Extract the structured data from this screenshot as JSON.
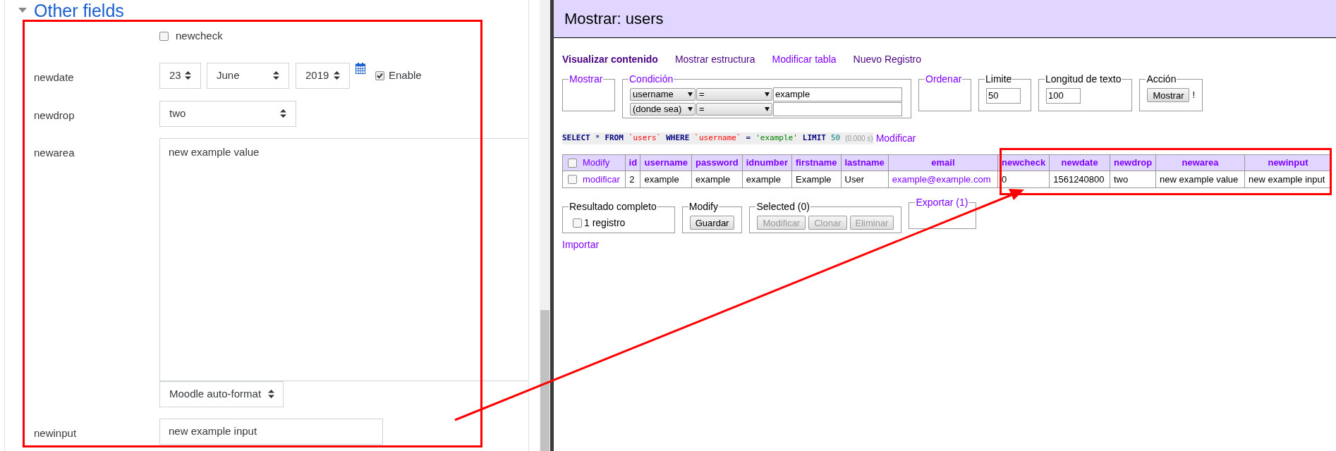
{
  "form": {
    "section": {
      "title": "Other fields",
      "expanded": true
    },
    "fields": [
      {
        "kind": "checkbox",
        "label": "newcheck",
        "checked": false
      },
      {
        "kind": "date",
        "label": "newdate",
        "day": "23",
        "month": "June",
        "year": "2019",
        "enable_label": "Enable",
        "enabled": true
      },
      {
        "kind": "select",
        "label": "newdrop",
        "value": "two"
      },
      {
        "kind": "textarea",
        "label": "newarea",
        "value": "new example value",
        "format": "Moodle auto-format"
      },
      {
        "kind": "input",
        "label": "newinput",
        "value": "new example input"
      }
    ]
  },
  "adminer": {
    "title": "Mostrar: users",
    "nav": [
      {
        "label": "Visualizar contenido",
        "selected": true,
        "visited": true
      },
      {
        "label": "Mostrar estructura",
        "selected": false,
        "visited": true
      },
      {
        "label": "Modificar tabla",
        "selected": false,
        "visited": false
      },
      {
        "label": "Nuevo Registro",
        "selected": false,
        "visited": true
      }
    ],
    "filters": [
      {
        "kind": "empty",
        "legend": "Mostrar",
        "legend_link": true
      },
      {
        "kind": "condition",
        "legend": "Condición",
        "legend_link": true,
        "rows": [
          {
            "column": "username",
            "operator": "=",
            "value": "example"
          },
          {
            "column": "(donde sea)",
            "operator": "=",
            "value": ""
          }
        ]
      },
      {
        "kind": "empty",
        "legend": "Ordenar",
        "legend_link": true
      },
      {
        "kind": "input",
        "legend": "Limite",
        "legend_link": false,
        "value": "50"
      },
      {
        "kind": "input",
        "legend": "Longitud de texto",
        "legend_link": false,
        "value": "100"
      },
      {
        "kind": "action",
        "legend": "Acción",
        "legend_link": false,
        "button": "Mostrar",
        "note": "!"
      }
    ],
    "sql": {
      "tokens": [
        {
          "kind": "keyword",
          "text": "SELECT"
        },
        {
          "kind": "operator",
          "text": "*"
        },
        {
          "kind": "keyword",
          "text": "FROM"
        },
        {
          "kind": "identifier",
          "text": "`users`"
        },
        {
          "kind": "keyword",
          "text": "WHERE"
        },
        {
          "kind": "identifier",
          "text": "`username`"
        },
        {
          "kind": "operator",
          "text": "="
        },
        {
          "kind": "string",
          "text": "'example'"
        },
        {
          "kind": "keyword",
          "text": "LIMIT"
        },
        {
          "kind": "number",
          "text": "50"
        }
      ],
      "time": "(0.000 s)",
      "edit_link": "Modificar"
    },
    "table": {
      "columns": [
        {
          "label": "Modify",
          "kind": "select-all",
          "checked": false
        },
        {
          "label": "id",
          "kind": "field"
        },
        {
          "label": "username",
          "kind": "field"
        },
        {
          "label": "password",
          "kind": "field"
        },
        {
          "label": "idnumber",
          "kind": "field"
        },
        {
          "label": "firstname",
          "kind": "field"
        },
        {
          "label": "lastname",
          "kind": "field"
        },
        {
          "label": "email",
          "kind": "field"
        },
        {
          "label": "newcheck",
          "kind": "field"
        },
        {
          "label": "newdate",
          "kind": "field"
        },
        {
          "label": "newdrop",
          "kind": "field"
        },
        {
          "label": "newarea",
          "kind": "field"
        },
        {
          "label": "newinput",
          "kind": "field"
        }
      ],
      "rows": [
        {
          "selected": false,
          "cells": [
            {
              "text": "modificar",
              "kind": "action"
            },
            {
              "text": "2",
              "kind": "text"
            },
            {
              "text": "example",
              "kind": "text"
            },
            {
              "text": "example",
              "kind": "text"
            },
            {
              "text": "example",
              "kind": "text"
            },
            {
              "text": "Example",
              "kind": "text"
            },
            {
              "text": "User",
              "kind": "text"
            },
            {
              "text": "example@example.com",
              "kind": "link"
            },
            {
              "text": "0",
              "kind": "text"
            },
            {
              "text": "1561240800",
              "kind": "text"
            },
            {
              "text": "two",
              "kind": "text"
            },
            {
              "text": "new example value",
              "kind": "text"
            },
            {
              "text": "new example input",
              "kind": "text"
            }
          ]
        }
      ]
    },
    "actions": [
      {
        "kind": "checkbox",
        "legend": "Resultado completo",
        "legend_link": false,
        "label": "1 registro",
        "checked": false
      },
      {
        "kind": "buttons",
        "legend": "Modify",
        "legend_link": false,
        "buttons": [
          {
            "label": "Guardar",
            "disabled": false
          }
        ]
      },
      {
        "kind": "buttons",
        "legend": "Selected (0)",
        "legend_link": false,
        "buttons": [
          {
            "label": "Modificar",
            "disabled": true
          },
          {
            "label": "Clonar",
            "disabled": true
          },
          {
            "label": "Eliminar",
            "disabled": true
          }
        ]
      },
      {
        "kind": "empty",
        "legend": "Exportar (1)",
        "legend_link": true
      }
    ],
    "import_link": "Importar"
  }
}
